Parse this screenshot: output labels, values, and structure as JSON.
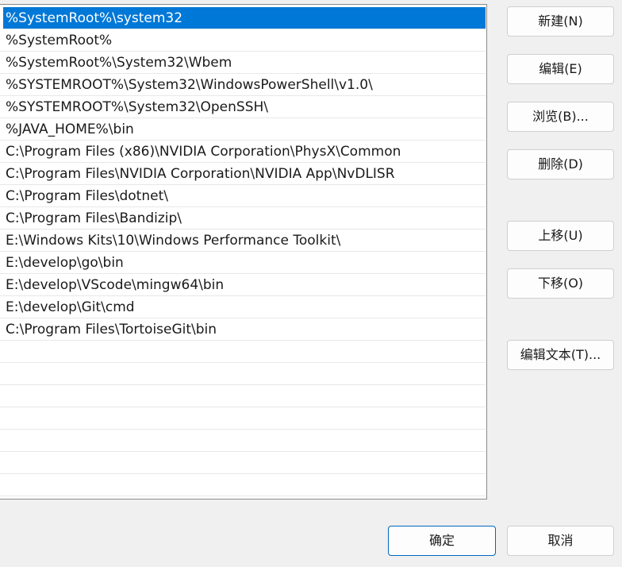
{
  "path_list": {
    "items": [
      {
        "label": "%SystemRoot%\\system32",
        "selected": true
      },
      {
        "label": "%SystemRoot%"
      },
      {
        "label": "%SystemRoot%\\System32\\Wbem"
      },
      {
        "label": "%SYSTEMROOT%\\System32\\WindowsPowerShell\\v1.0\\"
      },
      {
        "label": "%SYSTEMROOT%\\System32\\OpenSSH\\"
      },
      {
        "label": "%JAVA_HOME%\\bin"
      },
      {
        "label": "C:\\Program Files (x86)\\NVIDIA Corporation\\PhysX\\Common"
      },
      {
        "label": "C:\\Program Files\\NVIDIA Corporation\\NVIDIA App\\NvDLISR"
      },
      {
        "label": "C:\\Program Files\\dotnet\\"
      },
      {
        "label": "C:\\Program Files\\Bandizip\\"
      },
      {
        "label": "E:\\Windows Kits\\10\\Windows Performance Toolkit\\"
      },
      {
        "label": "E:\\develop\\go\\bin"
      },
      {
        "label": "E:\\develop\\VScode\\mingw64\\bin"
      },
      {
        "label": "E:\\develop\\Git\\cmd"
      },
      {
        "label": "C:\\Program Files\\TortoiseGit\\bin"
      },
      {
        "label": ""
      },
      {
        "label": ""
      },
      {
        "label": ""
      },
      {
        "label": ""
      },
      {
        "label": ""
      },
      {
        "label": ""
      },
      {
        "label": ""
      }
    ]
  },
  "side_buttons": {
    "new": "新建(N)",
    "edit": "编辑(E)",
    "browse": "浏览(B)...",
    "delete": "删除(D)",
    "move_up": "上移(U)",
    "move_down": "下移(O)",
    "edit_text": "编辑文本(T)..."
  },
  "footer": {
    "ok": "确定",
    "cancel": "取消"
  },
  "colors": {
    "selection": "#0078d7",
    "primary_border": "#0067c0",
    "background": "#f0f0f0"
  }
}
